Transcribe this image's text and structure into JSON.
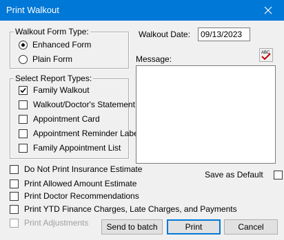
{
  "window": {
    "title": "Print Walkout"
  },
  "form_type": {
    "legend": "Walkout Form Type:",
    "options": [
      {
        "label": "Enhanced Form",
        "selected": true
      },
      {
        "label": "Plain Form",
        "selected": false
      }
    ]
  },
  "report_types": {
    "legend": "Select Report Types:",
    "items": [
      {
        "label": "Family Walkout",
        "checked": true
      },
      {
        "label": "Walkout/Doctor's Statement",
        "checked": false
      },
      {
        "label": "Appointment Card",
        "checked": false
      },
      {
        "label": "Appointment Reminder Label",
        "checked": false
      },
      {
        "label": "Family Appointment List",
        "checked": false
      }
    ]
  },
  "walkout_date": {
    "label": "Walkout Date:",
    "value": "09/13/2023"
  },
  "message": {
    "label": "Message:",
    "value": ""
  },
  "options": [
    {
      "label": "Do Not Print Insurance Estimate",
      "checked": false,
      "enabled": true
    },
    {
      "label": "Print Allowed Amount Estimate",
      "checked": false,
      "enabled": true
    },
    {
      "label": "Print Doctor Recommendations",
      "checked": false,
      "enabled": true
    },
    {
      "label": "Print YTD Finance Charges, Late Charges, and Payments",
      "checked": false,
      "enabled": true
    },
    {
      "label": "Print Adjustments",
      "checked": false,
      "enabled": false
    }
  ],
  "save_default": {
    "label": "Save as Default",
    "checked": false
  },
  "buttons": {
    "send_to_batch": "Send to batch",
    "print": "Print",
    "cancel": "Cancel"
  },
  "icons": {
    "close": "close-icon",
    "spellcheck": "spellcheck-icon"
  },
  "colors": {
    "titlebar": "#0078d7",
    "background": "#f0f0f0",
    "disabled_text": "#a0a0a0",
    "spellcheck_mark": "#c00000"
  }
}
